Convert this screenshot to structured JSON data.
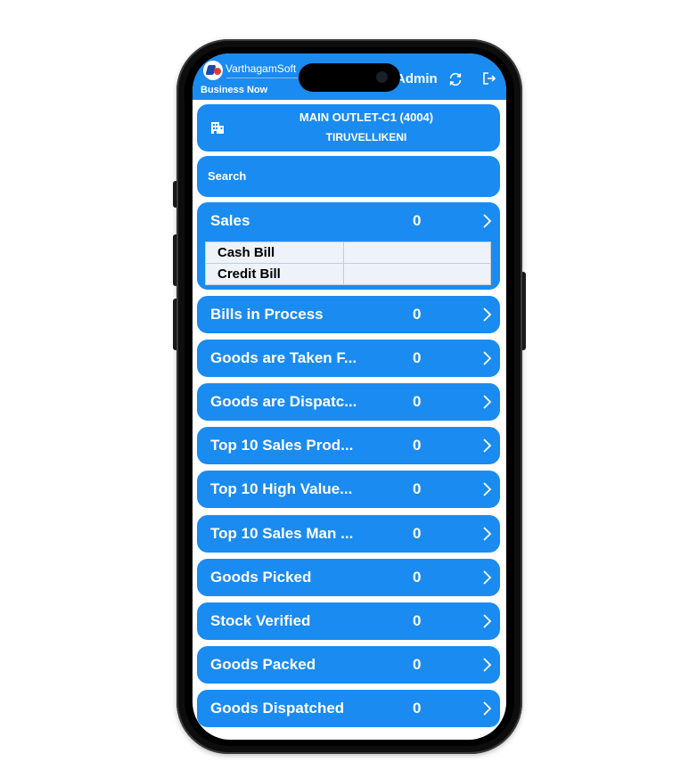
{
  "header": {
    "brand": "VarthagamSoft",
    "subtitle": "Business Now",
    "user": "Admin"
  },
  "outlet": {
    "name": "MAIN OUTLET-C1 (4004)",
    "location": "TIRUVELLIKENI"
  },
  "search": {
    "label": "Search"
  },
  "sales": {
    "title": "Sales",
    "value": "0",
    "items": [
      "Cash Bill",
      "Credit Bill"
    ]
  },
  "menu": [
    {
      "title": "Bills in Process",
      "value": "0"
    },
    {
      "title": "Goods are Taken F...",
      "value": "0"
    },
    {
      "title": "Goods are Dispatc...",
      "value": "0"
    },
    {
      "title": "Top 10 Sales Prod...",
      "value": "0"
    },
    {
      "title": "Top 10 High Value...",
      "value": "0"
    },
    {
      "title": "Top 10 Sales Man ...",
      "value": "0"
    },
    {
      "title": "Goods Picked",
      "value": "0"
    },
    {
      "title": "Stock Verified",
      "value": "0"
    },
    {
      "title": "Goods Packed",
      "value": "0"
    },
    {
      "title": "Goods Dispatched",
      "value": "0"
    }
  ],
  "icons": {
    "refresh": "refresh-icon",
    "logout": "logout-icon",
    "building": "building-icon",
    "chevron": "chevron-right-icon"
  },
  "colors": {
    "primary": "#1a8bf0",
    "table_bg": "#eef3f9"
  }
}
